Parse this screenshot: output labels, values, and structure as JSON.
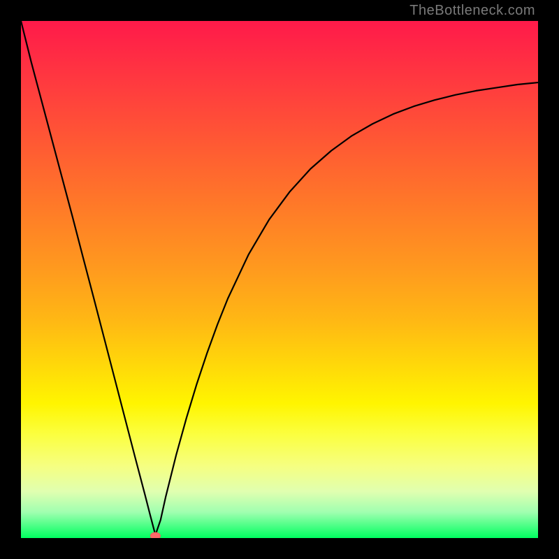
{
  "watermark": "TheBottleneck.com",
  "chart_data": {
    "type": "line",
    "title": "",
    "xlabel": "",
    "ylabel": "",
    "xlim": [
      0,
      100
    ],
    "ylim": [
      0,
      100
    ],
    "grid": false,
    "legend": false,
    "gradient": {
      "orientation": "vertical",
      "top_color": "#ff1a4a",
      "bottom_color": "#00ff60",
      "stops": [
        "red",
        "orange",
        "yellow",
        "green"
      ]
    },
    "marker": {
      "x": 26,
      "y": 0,
      "color": "#ff6a6a",
      "size": 8
    },
    "series": [
      {
        "name": "bottleneck-curve",
        "color": "#000000",
        "x": [
          0,
          2,
          4,
          6,
          8,
          10,
          12,
          14,
          16,
          18,
          20,
          22,
          24,
          25,
          26,
          27,
          28,
          30,
          32,
          34,
          36,
          38,
          40,
          44,
          48,
          52,
          56,
          60,
          64,
          68,
          72,
          76,
          80,
          84,
          88,
          92,
          96,
          100
        ],
        "y": [
          100,
          92,
          84.5,
          77,
          69.5,
          62,
          54.3,
          46.7,
          39,
          31.3,
          23.6,
          15.9,
          8.3,
          4.4,
          0.6,
          3.5,
          8,
          16,
          23.2,
          29.8,
          35.8,
          41.3,
          46.3,
          54.8,
          61.6,
          67,
          71.4,
          74.9,
          77.8,
          80.1,
          82,
          83.5,
          84.7,
          85.7,
          86.5,
          87.1,
          87.7,
          88.1
        ]
      }
    ]
  }
}
